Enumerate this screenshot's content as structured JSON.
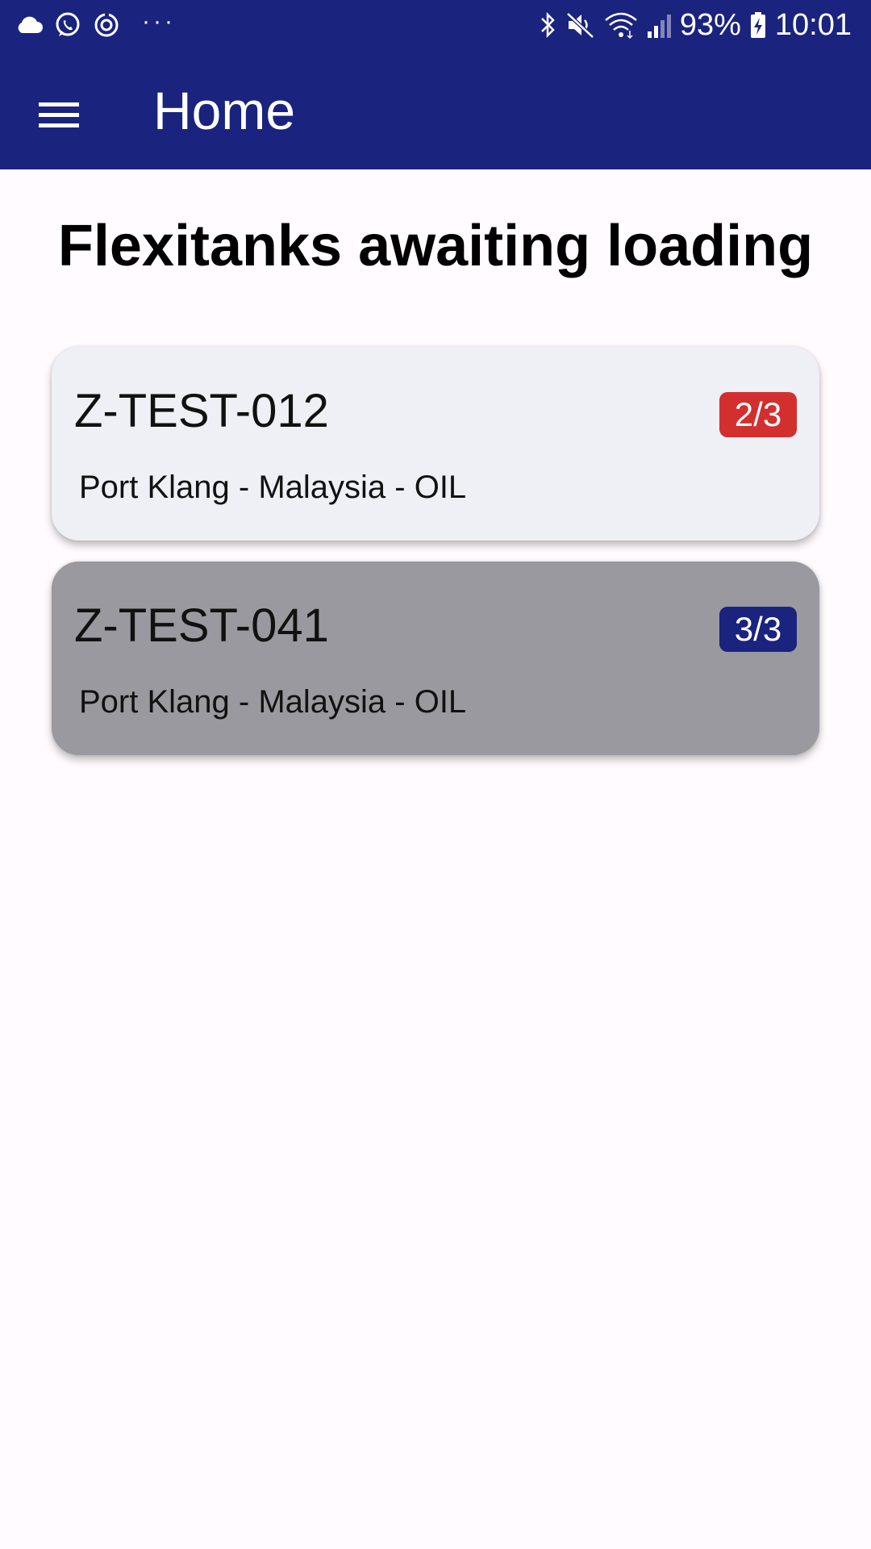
{
  "status_bar": {
    "battery_percent": "93%",
    "time": "10:01",
    "left_icons": [
      "cloud-icon",
      "whatsapp-icon",
      "sync-icon"
    ],
    "overflow_dots": "···",
    "right_icons": [
      "bluetooth-icon",
      "mute-icon",
      "wifi-icon",
      "signal-icon",
      "battery-charging-icon"
    ]
  },
  "app_bar": {
    "title": "Home",
    "menu_icon": "hamburger-menu-icon",
    "background_color": "#1a237e"
  },
  "page": {
    "heading": "Flexitanks awaiting loading"
  },
  "flexitanks": [
    {
      "id": "Z-TEST-012",
      "route": "Port Klang - Malaysia - OIL",
      "badge": "2/3",
      "badge_color": "#d32f2f",
      "card_color": "#eef0f5"
    },
    {
      "id": "Z-TEST-041",
      "route": "Port Klang - Malaysia - OIL",
      "badge": "3/3",
      "badge_color": "#1a237e",
      "card_color": "#99999f"
    }
  ]
}
